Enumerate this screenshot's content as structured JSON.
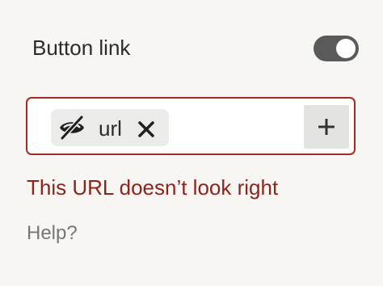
{
  "toggle": {
    "label": "Button link",
    "state": "on"
  },
  "url_field": {
    "chip": {
      "icon": "eye-off-icon",
      "label": "url"
    },
    "remove_icon": "close-icon",
    "add_icon": "plus-icon"
  },
  "error_message": "This URL doesn’t look right",
  "help_link": "Help?",
  "colors": {
    "background": "#f7f6f3",
    "error": "#a32c22",
    "toggle_on": "#5a5a5a",
    "chip_bg": "#ebebea",
    "add_button_bg": "#e3e3e2",
    "muted_text": "#777777"
  }
}
